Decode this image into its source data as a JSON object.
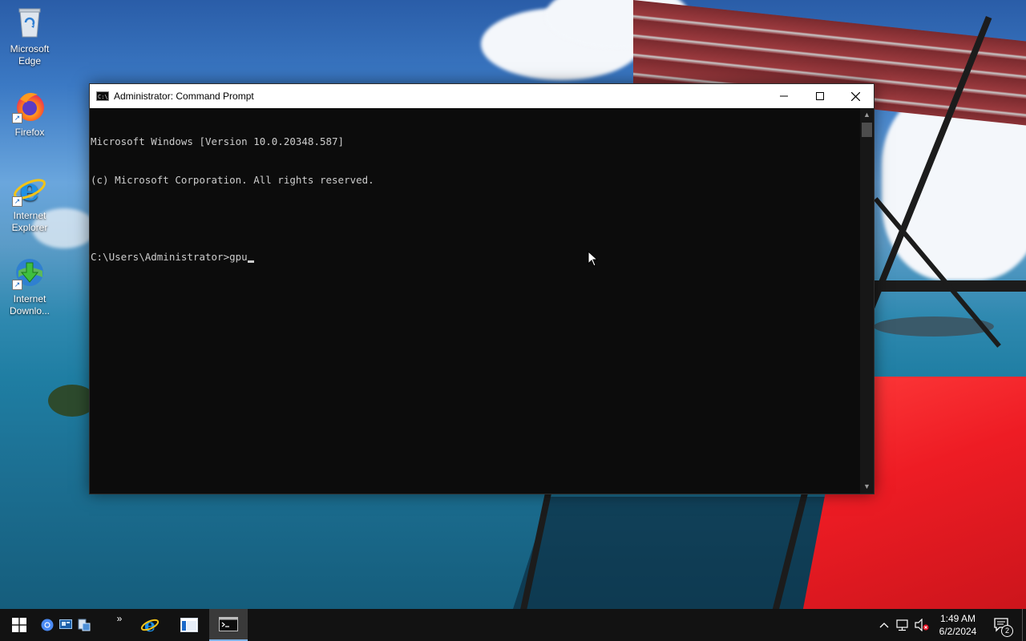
{
  "desktop": {
    "icons": [
      {
        "label": "Microsoft Edge",
        "icon": "recycle-bin-icon"
      },
      {
        "label": "Firefox",
        "icon": "firefox-icon"
      },
      {
        "label": "Internet Explorer",
        "icon": "internet-explorer-icon"
      },
      {
        "label": "Internet Downlo...",
        "icon": "internet-download-manager-icon"
      }
    ]
  },
  "window": {
    "title": "Administrator: Command Prompt",
    "icon": "cmd-icon",
    "console_lines": [
      "Microsoft Windows [Version 10.0.20348.587]",
      "(c) Microsoft Corporation. All rights reserved.",
      "",
      "C:\\Users\\Administrator>gpu"
    ]
  },
  "taskbar": {
    "clock_time": "1:49 AM",
    "clock_date": "6/2/2024",
    "notification_count": "2",
    "overflow_chevron": "»"
  },
  "colors": {
    "console_bg": "#0c0c0c",
    "console_text": "#cccccc",
    "taskbar_bg": "#121212",
    "wing_red": "#ee1c24"
  }
}
